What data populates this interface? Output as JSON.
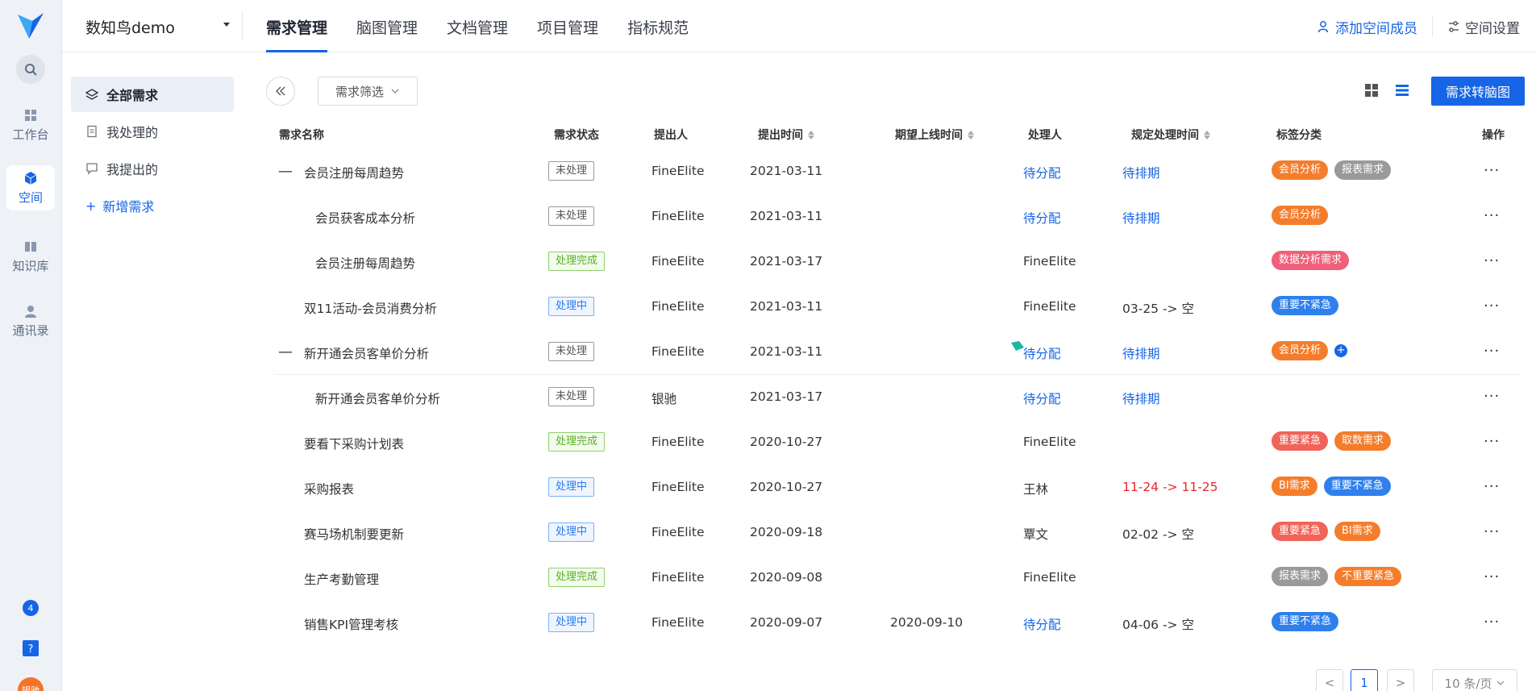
{
  "rail": {
    "items": [
      {
        "label": "工作台"
      },
      {
        "label": "空间"
      },
      {
        "label": "知识库"
      },
      {
        "label": "通讯录"
      }
    ],
    "avatar_text": "银驰"
  },
  "header": {
    "space_name": "数知鸟demo",
    "tabs": [
      "需求管理",
      "脑图管理",
      "文档管理",
      "项目管理",
      "指标规范"
    ],
    "add_member": "添加空间成员",
    "space_settings": "空间设置"
  },
  "subnav": {
    "items": [
      "全部需求",
      "我处理的",
      "我提出的"
    ],
    "add_label": "新增需求"
  },
  "toolbar": {
    "filter_label": "需求筛选",
    "primary_label": "需求转脑图"
  },
  "table": {
    "columns": [
      "需求名称",
      "需求状态",
      "提出人",
      "提出时间",
      "期望上线时间",
      "处理人",
      "规定处理时间",
      "标签分类",
      "操作"
    ],
    "rows": [
      {
        "toggle": "—",
        "name": "会员注册每周趋势",
        "status": "未处理",
        "proposer": "FineElite",
        "date": "2021-03-11",
        "expected": "",
        "handler": "待分配",
        "deadline": "待排期",
        "tags": [
          {
            "text": "会员分析",
            "color": "orange"
          },
          {
            "text": "报表需求",
            "color": "gray"
          }
        ]
      },
      {
        "toggle": "",
        "name": "会员获客成本分析",
        "status": "未处理",
        "proposer": "FineElite",
        "date": "2021-03-11",
        "expected": "",
        "handler": "待分配",
        "deadline": "待排期",
        "tags": [
          {
            "text": "会员分析",
            "color": "orange"
          }
        ]
      },
      {
        "toggle": "",
        "name": "会员注册每周趋势",
        "status": "处理完成",
        "proposer": "FineElite",
        "date": "2021-03-17",
        "expected": "",
        "handler": "FineElite",
        "deadline": "",
        "tags": [
          {
            "text": "数据分析需求",
            "color": "pink"
          }
        ]
      },
      {
        "toggle": "",
        "name": "双11活动-会员消费分析",
        "status": "处理中",
        "proposer": "FineElite",
        "date": "2021-03-11",
        "expected": "",
        "handler": "FineElite",
        "deadline": "03-25 -> 空",
        "tags": [
          {
            "text": "重要不紧急",
            "color": "blue"
          }
        ]
      },
      {
        "toggle": "—",
        "name": "新开通会员客单价分析",
        "status": "未处理",
        "proposer": "FineElite",
        "date": "2021-03-11",
        "expected": "",
        "handler": "待分配",
        "deadline": "待排期",
        "tags": [
          {
            "text": "会员分析",
            "color": "orange"
          }
        ]
      },
      {
        "toggle": "",
        "name": "新开通会员客单价分析",
        "status": "未处理",
        "proposer": "银驰",
        "date": "2021-03-17",
        "expected": "",
        "handler": "待分配",
        "deadline": "待排期",
        "tags": []
      },
      {
        "toggle": "",
        "name": "要看下采购计划表",
        "status": "处理完成",
        "proposer": "FineElite",
        "date": "2020-10-27",
        "expected": "",
        "handler": "FineElite",
        "deadline": "",
        "tags": [
          {
            "text": "重要紧急",
            "color": "red"
          },
          {
            "text": "取数需求",
            "color": "orange"
          }
        ]
      },
      {
        "toggle": "",
        "name": "采购报表",
        "status": "处理中",
        "proposer": "FineElite",
        "date": "2020-10-27",
        "expected": "",
        "handler": "王林",
        "deadline": "11-24 -> 11-25",
        "tags": [
          {
            "text": "BI需求",
            "color": "orange"
          },
          {
            "text": "重要不紧急",
            "color": "blue"
          }
        ]
      },
      {
        "toggle": "",
        "name": "赛马场机制要更新",
        "status": "处理中",
        "proposer": "FineElite",
        "date": "2020-09-18",
        "expected": "",
        "handler": "覃文",
        "deadline": "02-02 -> 空",
        "tags": [
          {
            "text": "重要紧急",
            "color": "red"
          },
          {
            "text": "BI需求",
            "color": "orange"
          }
        ]
      },
      {
        "toggle": "",
        "name": "生产考勤管理",
        "status": "处理完成",
        "proposer": "FineElite",
        "date": "2020-09-08",
        "expected": "",
        "handler": "FineElite",
        "deadline": "",
        "tags": [
          {
            "text": "报表需求",
            "color": "gray"
          },
          {
            "text": "不重要紧急",
            "color": "orange"
          }
        ]
      },
      {
        "toggle": "",
        "name": "销售KPI管理考核",
        "status": "处理中",
        "proposer": "FineElite",
        "date": "2020-09-07",
        "expected": "2020-09-10",
        "handler": "待分配",
        "deadline": "04-06 -> 空",
        "tags": [
          {
            "text": "重要不紧急",
            "color": "blue"
          }
        ]
      }
    ],
    "ops": "···"
  },
  "pagination": {
    "prev": "<",
    "current": "1",
    "next": ">",
    "page_size": "10 条/页"
  },
  "colors": {
    "primary": "#1565e6",
    "tag_orange": "#f47d2c",
    "tag_gray": "#9a9a9a",
    "tag_blue": "#2f80ed",
    "tag_red": "#f0645a",
    "tag_pink": "#f0607a",
    "overdue_red": "#e6262d"
  }
}
